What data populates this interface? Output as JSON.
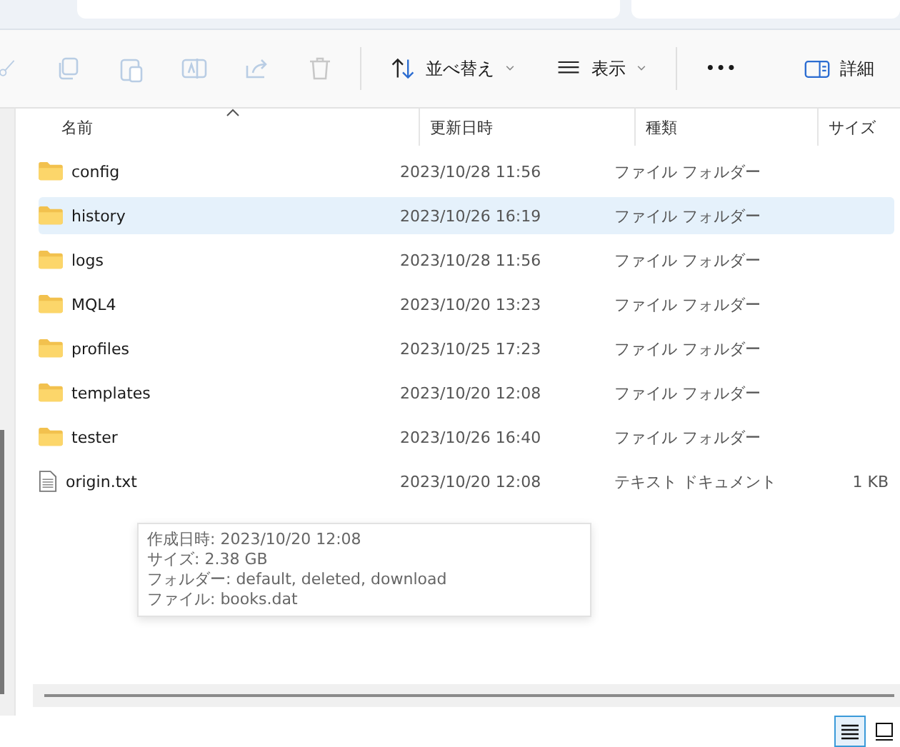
{
  "toolbar": {
    "sort_button": "並べ替え",
    "view_button": "表示",
    "more_button": "•••",
    "details_button": "詳細"
  },
  "table": {
    "columns": [
      {
        "label": "名前",
        "sorted": true
      },
      {
        "label": "更新日時",
        "sorted": false
      },
      {
        "label": "種類",
        "sorted": false
      },
      {
        "label": "サイズ",
        "sorted": false
      }
    ],
    "rows": [
      {
        "kind": "folder",
        "name": "config",
        "modified": "2023/10/28 11:56",
        "type": "ファイル フォルダー",
        "size": "",
        "selected": false
      },
      {
        "kind": "folder",
        "name": "history",
        "modified": "2023/10/26 16:19",
        "type": "ファイル フォルダー",
        "size": "",
        "selected": true
      },
      {
        "kind": "folder",
        "name": "logs",
        "modified": "2023/10/28 11:56",
        "type": "ファイル フォルダー",
        "size": "",
        "selected": false
      },
      {
        "kind": "folder",
        "name": "MQL4",
        "modified": "2023/10/20 13:23",
        "type": "ファイル フォルダー",
        "size": "",
        "selected": false
      },
      {
        "kind": "folder",
        "name": "profiles",
        "modified": "2023/10/25 17:23",
        "type": "ファイル フォルダー",
        "size": "",
        "selected": false
      },
      {
        "kind": "folder",
        "name": "templates",
        "modified": "2023/10/20 12:08",
        "type": "ファイル フォルダー",
        "size": "",
        "selected": false
      },
      {
        "kind": "folder",
        "name": "tester",
        "modified": "2023/10/26 16:40",
        "type": "ファイル フォルダー",
        "size": "",
        "selected": false
      },
      {
        "kind": "file",
        "name": "origin.txt",
        "modified": "2023/10/20 12:08",
        "type": "テキスト ドキュメント",
        "size": "1 KB",
        "selected": false
      }
    ]
  },
  "tooltip": {
    "lines": [
      "作成日時: 2023/10/20 12:08",
      "サイズ: 2.38 GB",
      "フォルダー: default, deleted, download",
      "ファイル: books.dat"
    ]
  },
  "status_bar": {
    "views": [
      {
        "kind": "details",
        "selected": true
      },
      {
        "kind": "tiles",
        "selected": false
      }
    ]
  }
}
